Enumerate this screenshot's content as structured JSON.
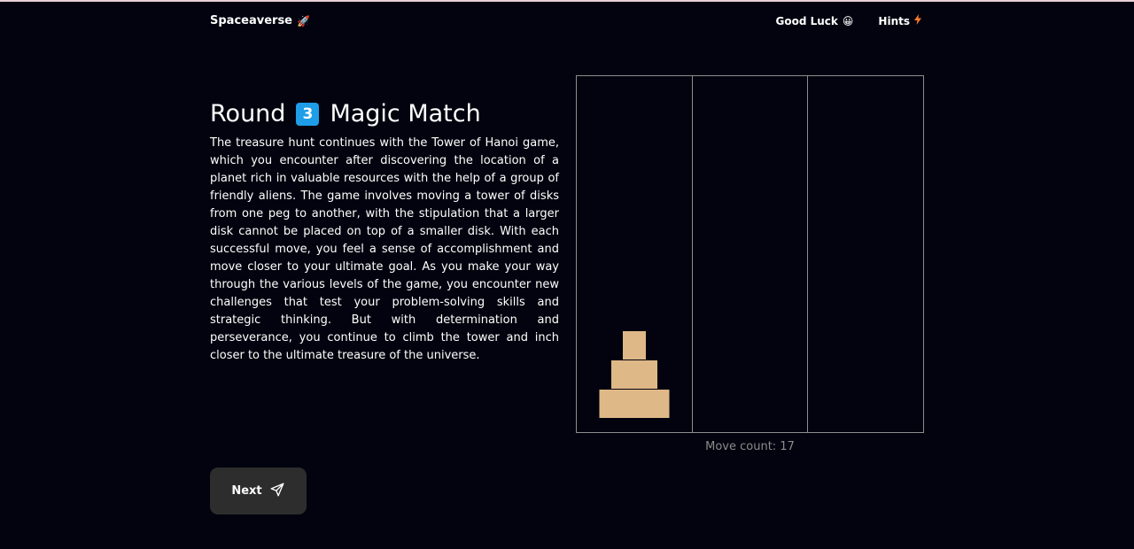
{
  "header": {
    "brand": "Spaceaverse",
    "brand_icon": "rocket-icon",
    "nav": [
      {
        "label": "Good Luck",
        "icon": "grinning-face-icon"
      },
      {
        "label": "Hints",
        "icon": "lightning-icon"
      }
    ]
  },
  "title": {
    "prefix": "Round",
    "round_number": "3",
    "name": "Magic Match"
  },
  "story": "The treasure hunt continues with the Tower of Hanoi game, which you encounter after discovering the location of a planet rich in valuable resources with the help of a group of friendly aliens. The game involves moving a tower of disks from one peg to another, with the stipulation that a larger disk cannot be placed on top of a smaller disk. With each successful move, you feel a sense of accomplishment and move closer to your ultimate goal. As you make your way through the various levels of the game, you encounter new challenges that test your problem-solving skills and strategic thinking. But with determination and perseverance, you continue to climb the tower and inch closer to the ultimate treasure of the universe.",
  "game": {
    "pegs": [
      {
        "disks": [
          3,
          2,
          1
        ]
      },
      {
        "disks": []
      },
      {
        "disks": []
      }
    ],
    "disk_color": "#dfb887",
    "move_count_label": "Move count: 17"
  },
  "actions": {
    "next_label": "Next",
    "next_icon": "send-icon"
  },
  "colors": {
    "background": "#03030f",
    "badge": "#1e9de8",
    "button": "#2d2d2d",
    "border": "#8e8e8e"
  }
}
